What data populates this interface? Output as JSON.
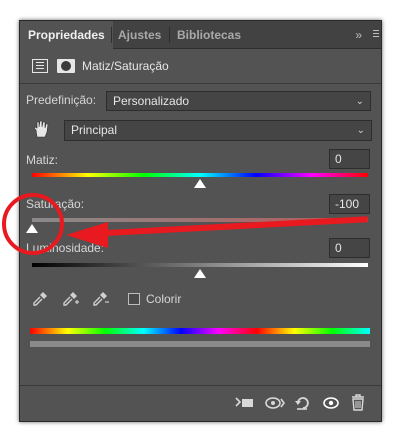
{
  "tabs": [
    {
      "label": "Propriedades",
      "active": true
    },
    {
      "label": "Ajustes",
      "active": false
    },
    {
      "label": "Bibliotecas",
      "active": false
    }
  ],
  "tab_menu_label": "»",
  "adjustment": {
    "title": "Matiz/Saturação"
  },
  "preset": {
    "label": "Predefinição:",
    "value": "Personalizado"
  },
  "channel": {
    "value": "Principal"
  },
  "sliders": {
    "hue": {
      "label": "Matiz:",
      "value": "0",
      "level": 0.5
    },
    "saturation": {
      "label": "Saturação:",
      "value": "-100",
      "level": 0.0
    },
    "lightness": {
      "label": "Luminosidade:",
      "value": "0",
      "level": 0.5
    }
  },
  "colorize": {
    "label": "Colorir",
    "checked": false
  },
  "colors": {
    "panel": "#535353",
    "annotation": "#e8191f"
  },
  "footer_icons": [
    "clip-to-layer-icon",
    "view-previous-state-icon",
    "reset-icon",
    "visibility-eye-icon",
    "delete-trash-icon"
  ]
}
